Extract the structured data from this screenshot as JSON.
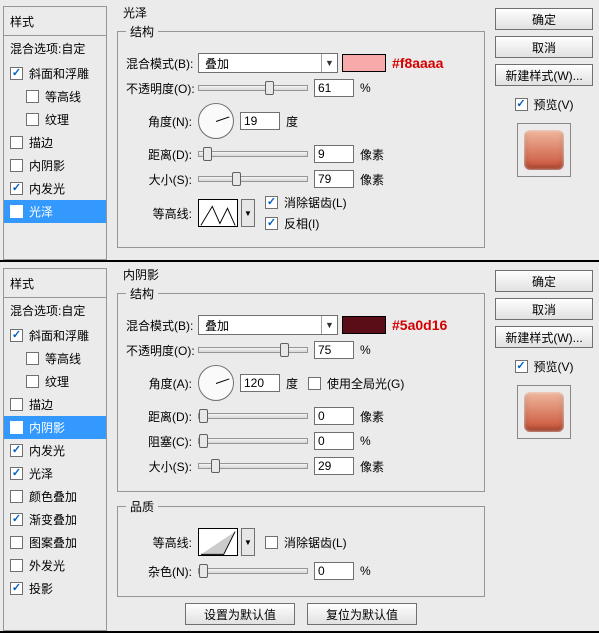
{
  "panels": [
    {
      "styles_title": "样式",
      "blend_options": "混合选项:自定",
      "style_items": [
        {
          "label": "斜面和浮雕",
          "checked": true,
          "selected": false,
          "indent": false
        },
        {
          "label": "等高线",
          "checked": false,
          "selected": false,
          "indent": true
        },
        {
          "label": "纹理",
          "checked": false,
          "selected": false,
          "indent": true
        },
        {
          "label": "描边",
          "checked": false,
          "selected": false,
          "indent": false
        },
        {
          "label": "内阴影",
          "checked": false,
          "selected": false,
          "indent": false
        },
        {
          "label": "内发光",
          "checked": true,
          "selected": false,
          "indent": false
        },
        {
          "label": "光泽",
          "checked": true,
          "selected": true,
          "indent": false
        }
      ],
      "section_title": "光泽",
      "structure_label": "结构",
      "blend_mode_label": "混合模式(B):",
      "blend_mode_value": "叠加",
      "swatch_color": "#f8aaaa",
      "swatch_annotation": "#f8aaaa",
      "opacity_label": "不透明度(O):",
      "opacity_value": "61",
      "opacity_unit": "%",
      "opacity_frac": 0.61,
      "angle_label": "角度(N):",
      "angle_value": "19",
      "angle_unit": "度",
      "distance_label": "距离(D):",
      "distance_value": "9",
      "distance_unit": "像素",
      "distance_frac": 0.04,
      "size_label": "大小(S):",
      "size_value": "79",
      "size_unit": "像素",
      "size_frac": 0.31,
      "contour_label": "等高线:",
      "antialias_label": "消除锯齿(L)",
      "antialias_checked": true,
      "invert_label": "反相(I)",
      "invert_checked": true,
      "right": {
        "ok": "确定",
        "cancel": "取消",
        "newstyle": "新建样式(W)...",
        "preview": "预览(V)",
        "preview_checked": true
      }
    },
    {
      "styles_title": "样式",
      "blend_options": "混合选项:自定",
      "style_items": [
        {
          "label": "斜面和浮雕",
          "checked": true,
          "selected": false,
          "indent": false
        },
        {
          "label": "等高线",
          "checked": false,
          "selected": false,
          "indent": true
        },
        {
          "label": "纹理",
          "checked": false,
          "selected": false,
          "indent": true
        },
        {
          "label": "描边",
          "checked": false,
          "selected": false,
          "indent": false
        },
        {
          "label": "内阴影",
          "checked": true,
          "selected": true,
          "indent": false
        },
        {
          "label": "内发光",
          "checked": true,
          "selected": false,
          "indent": false
        },
        {
          "label": "光泽",
          "checked": true,
          "selected": false,
          "indent": false
        },
        {
          "label": "颜色叠加",
          "checked": false,
          "selected": false,
          "indent": false
        },
        {
          "label": "渐变叠加",
          "checked": true,
          "selected": false,
          "indent": false
        },
        {
          "label": "图案叠加",
          "checked": false,
          "selected": false,
          "indent": false
        },
        {
          "label": "外发光",
          "checked": false,
          "selected": false,
          "indent": false
        },
        {
          "label": "投影",
          "checked": true,
          "selected": false,
          "indent": false
        }
      ],
      "section_title": "内阴影",
      "structure_label": "结构",
      "blend_mode_label": "混合模式(B):",
      "blend_mode_value": "叠加",
      "swatch_color": "#5a0d16",
      "swatch_annotation": "#5a0d16",
      "opacity_label": "不透明度(O):",
      "opacity_value": "75",
      "opacity_unit": "%",
      "opacity_frac": 0.75,
      "angle_label": "角度(A):",
      "angle_value": "120",
      "angle_unit": "度",
      "global_light_label": "使用全局光(G)",
      "global_light_checked": false,
      "distance_label": "距离(D):",
      "distance_value": "0",
      "distance_unit": "像素",
      "distance_frac": 0.0,
      "choke_label": "阻塞(C):",
      "choke_value": "0",
      "choke_unit": "%",
      "choke_frac": 0.0,
      "size_label": "大小(S):",
      "size_value": "29",
      "size_unit": "像素",
      "size_frac": 0.11,
      "quality_label": "品质",
      "contour_label": "等高线:",
      "antialias_label": "消除锯齿(L)",
      "antialias_checked": false,
      "noise_label": "杂色(N):",
      "noise_value": "0",
      "noise_unit": "%",
      "noise_frac": 0.0,
      "set_default": "设置为默认值",
      "reset_default": "复位为默认值",
      "right": {
        "ok": "确定",
        "cancel": "取消",
        "newstyle": "新建样式(W)...",
        "preview": "预览(V)",
        "preview_checked": true
      }
    }
  ]
}
